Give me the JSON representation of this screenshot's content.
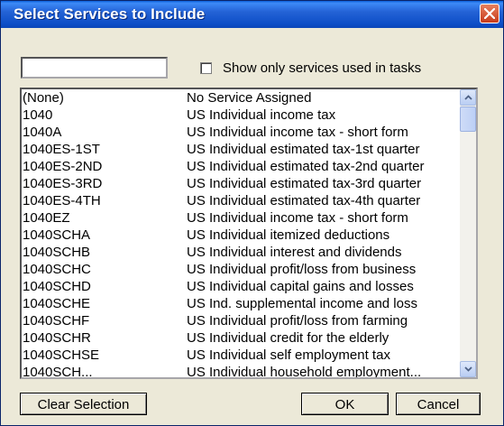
{
  "window": {
    "title": "Select Services to Include"
  },
  "filter": {
    "search_value": "",
    "show_only_label": "Show only services used in tasks",
    "show_only_checked": false
  },
  "services": [
    {
      "code": "(None)",
      "desc": "No Service Assigned"
    },
    {
      "code": "1040",
      "desc": "US Individual income tax"
    },
    {
      "code": "1040A",
      "desc": "US Individual income tax - short form"
    },
    {
      "code": "1040ES-1ST",
      "desc": "US Individual estimated tax-1st quarter"
    },
    {
      "code": "1040ES-2ND",
      "desc": "US Individual estimated tax-2nd quarter"
    },
    {
      "code": "1040ES-3RD",
      "desc": "US Individual estimated tax-3rd quarter"
    },
    {
      "code": "1040ES-4TH",
      "desc": "US Individual estimated tax-4th quarter"
    },
    {
      "code": "1040EZ",
      "desc": "US Individual income tax - short form"
    },
    {
      "code": "1040SCHA",
      "desc": "US Individual itemized deductions"
    },
    {
      "code": "1040SCHB",
      "desc": "US Individual interest and dividends"
    },
    {
      "code": "1040SCHC",
      "desc": "US Individual profit/loss from business"
    },
    {
      "code": "1040SCHD",
      "desc": "US Individual capital gains and losses"
    },
    {
      "code": "1040SCHE",
      "desc": "US Ind. supplemental income and loss"
    },
    {
      "code": "1040SCHF",
      "desc": "US Individual profit/loss from farming"
    },
    {
      "code": "1040SCHR",
      "desc": "US Individual credit for the elderly"
    },
    {
      "code": "1040SCHSE",
      "desc": "US Individual self employment tax"
    },
    {
      "code": "1040SCH...",
      "desc": "US Individual household employment..."
    }
  ],
  "buttons": {
    "clear": "Clear Selection",
    "ok": "OK",
    "cancel": "Cancel"
  }
}
